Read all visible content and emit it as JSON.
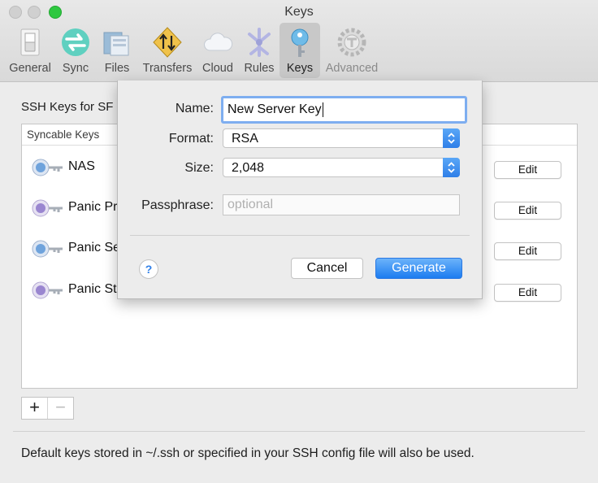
{
  "window": {
    "title": "Keys"
  },
  "toolbar": {
    "items": [
      {
        "label": "General",
        "icon": "general-switch-icon"
      },
      {
        "label": "Sync",
        "icon": "sync-arrows-icon"
      },
      {
        "label": "Files",
        "icon": "files-icon"
      },
      {
        "label": "Transfers",
        "icon": "transfers-icon"
      },
      {
        "label": "Cloud",
        "icon": "cloud-icon"
      },
      {
        "label": "Rules",
        "icon": "rules-icon"
      },
      {
        "label": "Keys",
        "icon": "key-icon"
      },
      {
        "label": "Advanced",
        "icon": "advanced-gear-icon"
      }
    ],
    "selected": "Keys"
  },
  "main": {
    "section_label": "SSH Keys for SF",
    "list_header": "Syncable Keys",
    "keys": [
      {
        "name": "NAS",
        "edit_label": "Edit"
      },
      {
        "name": "Panic Pr",
        "edit_label": "Edit"
      },
      {
        "name": "Panic Se",
        "edit_label": "Edit"
      },
      {
        "name": "Panic St",
        "edit_label": "Edit"
      }
    ],
    "add_label": "+",
    "remove_label": "−",
    "footer": "Default keys stored in ~/.ssh or specified in your SSH config file will also be used."
  },
  "dialog": {
    "name_label": "Name:",
    "name_value": "New Server Key",
    "format_label": "Format:",
    "format_value": "RSA",
    "size_label": "Size:",
    "size_value": "2,048",
    "passphrase_label": "Passphrase:",
    "passphrase_placeholder": "optional",
    "help_label": "?",
    "cancel_label": "Cancel",
    "generate_label": "Generate"
  },
  "colors": {
    "accent": "#2f7fe8",
    "focus_ring": "#7eaef0",
    "zoom_green": "#2ec840"
  }
}
